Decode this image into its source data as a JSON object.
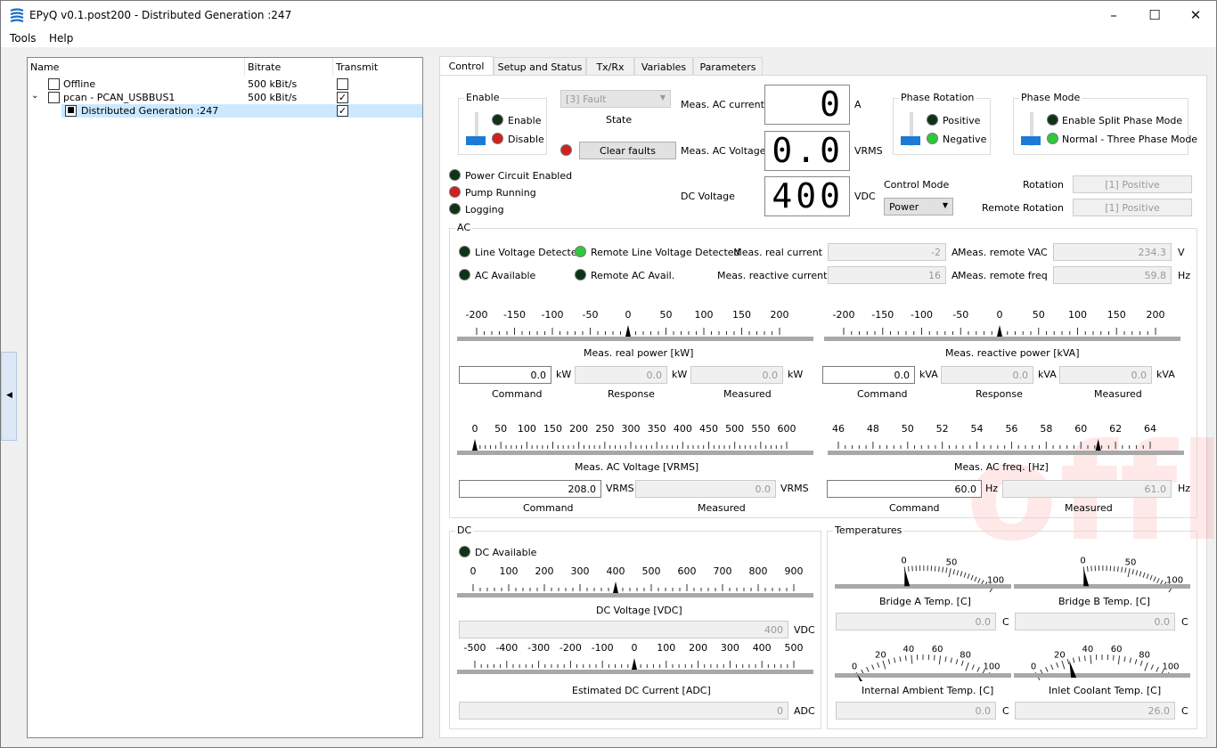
{
  "window": {
    "title": "EPyQ v0.1.post200 - Distributed Generation :247",
    "minimize": "–",
    "maximize": "☐",
    "close": "✕"
  },
  "menu": [
    "Tools",
    "Help"
  ],
  "tree": {
    "headers": [
      "Name",
      "Bitrate",
      "Transmit"
    ],
    "rows": [
      {
        "name": "Offline",
        "bitrate": "500 kBit/s",
        "transmit": ""
      },
      {
        "name": "pcan - PCAN_USBBUS1",
        "bitrate": "500 kBit/s",
        "transmit": "✓"
      },
      {
        "name": "Distributed Generation :247",
        "bitrate": "",
        "transmit": "✓"
      }
    ]
  },
  "tabs": [
    "Control",
    "Setup and Status",
    "Tx/Rx",
    "Variables",
    "Parameters"
  ],
  "control": {
    "enable": {
      "title": "Enable",
      "on": "Enable",
      "off": "Disable"
    },
    "state_value": "[3] Fault",
    "state_label": "State",
    "clear_faults": "Clear faults",
    "meas_ac_current": {
      "label": "Meas. AC current",
      "value": "0",
      "unit": "A"
    },
    "meas_ac_voltage": {
      "label": "Meas. AC Voltage",
      "value": "0.0",
      "unit": "VRMS"
    },
    "dc_voltage": {
      "label": "DC Voltage",
      "value": "400",
      "unit": "VDC"
    },
    "phase_rotation": {
      "title": "Phase Rotation",
      "a": "Positive",
      "b": "Negative"
    },
    "phase_mode": {
      "title": "Phase Mode",
      "a": "Enable Split Phase Mode",
      "b": "Normal - Three Phase Mode"
    },
    "control_mode": {
      "label": "Control Mode",
      "value": "Power"
    },
    "rotation": {
      "label": "Rotation",
      "value": "[1] Positive"
    },
    "remote_rotation": {
      "label": "Remote Rotation",
      "value": "[1] Positive"
    },
    "status": [
      "Power Circuit Enabled",
      "Pump Running",
      "Logging"
    ]
  },
  "ac": {
    "title": "AC",
    "leds": [
      "Line Voltage Detected",
      "Remote Line Voltage Detected",
      "AC Available",
      "Remote AC Avail."
    ],
    "meas_real_current": {
      "label": "Meas. real current",
      "value": "-2",
      "unit": "A"
    },
    "meas_reactive_current": {
      "label": "Meas. reactive current",
      "value": "16",
      "unit": "A"
    },
    "meas_remote_vac": {
      "label": "Meas. remote VAC",
      "value": "234.3",
      "unit": "V"
    },
    "meas_remote_freq": {
      "label": "Meas. remote freq",
      "value": "59.8",
      "unit": "Hz"
    },
    "real_power": {
      "title": "Meas. real power  [kW]",
      "ticks": [
        "-200",
        "-150",
        "-100",
        "-50",
        "0",
        "50",
        "100",
        "150",
        "200"
      ],
      "command": "0.0",
      "response": "0.0",
      "measured": "0.0",
      "unit": "kW"
    },
    "reactive_power": {
      "title": "Meas. reactive power  [kVA]",
      "ticks": [
        "-200",
        "-150",
        "-100",
        "-50",
        "0",
        "50",
        "100",
        "150",
        "200"
      ],
      "command": "0.0",
      "response": "0.0",
      "measured": "0.0",
      "unit": "kVA"
    },
    "voltage": {
      "title": "Meas. AC Voltage  [VRMS]",
      "ticks": [
        "0",
        "50",
        "100",
        "150",
        "200",
        "250",
        "300",
        "350",
        "400",
        "450",
        "500",
        "550",
        "600"
      ],
      "command": "208.0",
      "measured": "0.0",
      "unit": "VRMS"
    },
    "freq": {
      "title": "Meas. AC freq.  [Hz]",
      "ticks": [
        "46",
        "48",
        "50",
        "52",
        "54",
        "56",
        "58",
        "60",
        "62",
        "64"
      ],
      "command": "60.0",
      "measured": "61.0",
      "unit": "Hz"
    },
    "command_label": "Command",
    "response_label": "Response",
    "measured_label": "Measured"
  },
  "dc": {
    "title": "DC",
    "led": "DC Available",
    "voltage": {
      "title": "DC Voltage  [VDC]",
      "ticks": [
        "0",
        "100",
        "200",
        "300",
        "400",
        "500",
        "600",
        "700",
        "800",
        "900"
      ],
      "value": "400",
      "unit": "VDC"
    },
    "current": {
      "title": "Estimated DC Current  [ADC]",
      "ticks": [
        "-500",
        "-400",
        "-300",
        "-200",
        "-100",
        "0",
        "100",
        "200",
        "300",
        "400",
        "500"
      ],
      "value": "0",
      "unit": "ADC"
    }
  },
  "temps": {
    "title": "Temperatures",
    "a": {
      "title": "Bridge A Temp.  [C]",
      "ticks": [
        "0",
        "50",
        "100"
      ],
      "value": "0.0",
      "unit": "C"
    },
    "b": {
      "title": "Bridge B Temp.  [C]",
      "ticks": [
        "0",
        "50",
        "100"
      ],
      "value": "0.0",
      "unit": "C"
    },
    "c": {
      "title": "Internal Ambient Temp.  [C]",
      "ticks": [
        "0",
        "20",
        "40",
        "60",
        "80",
        "100"
      ],
      "value": "0.0",
      "unit": "C"
    },
    "d": {
      "title": "Inlet Coolant Temp.  [C]",
      "ticks": [
        "0",
        "20",
        "40",
        "60",
        "80",
        "100"
      ],
      "value": "26.0",
      "unit": "C"
    }
  },
  "watermark": "offline",
  "colors": {
    "led_dark": "#0f3318",
    "led_green": "#2ec93a",
    "led_red": "#d02020",
    "slider_blue": "#1b7bd6"
  }
}
